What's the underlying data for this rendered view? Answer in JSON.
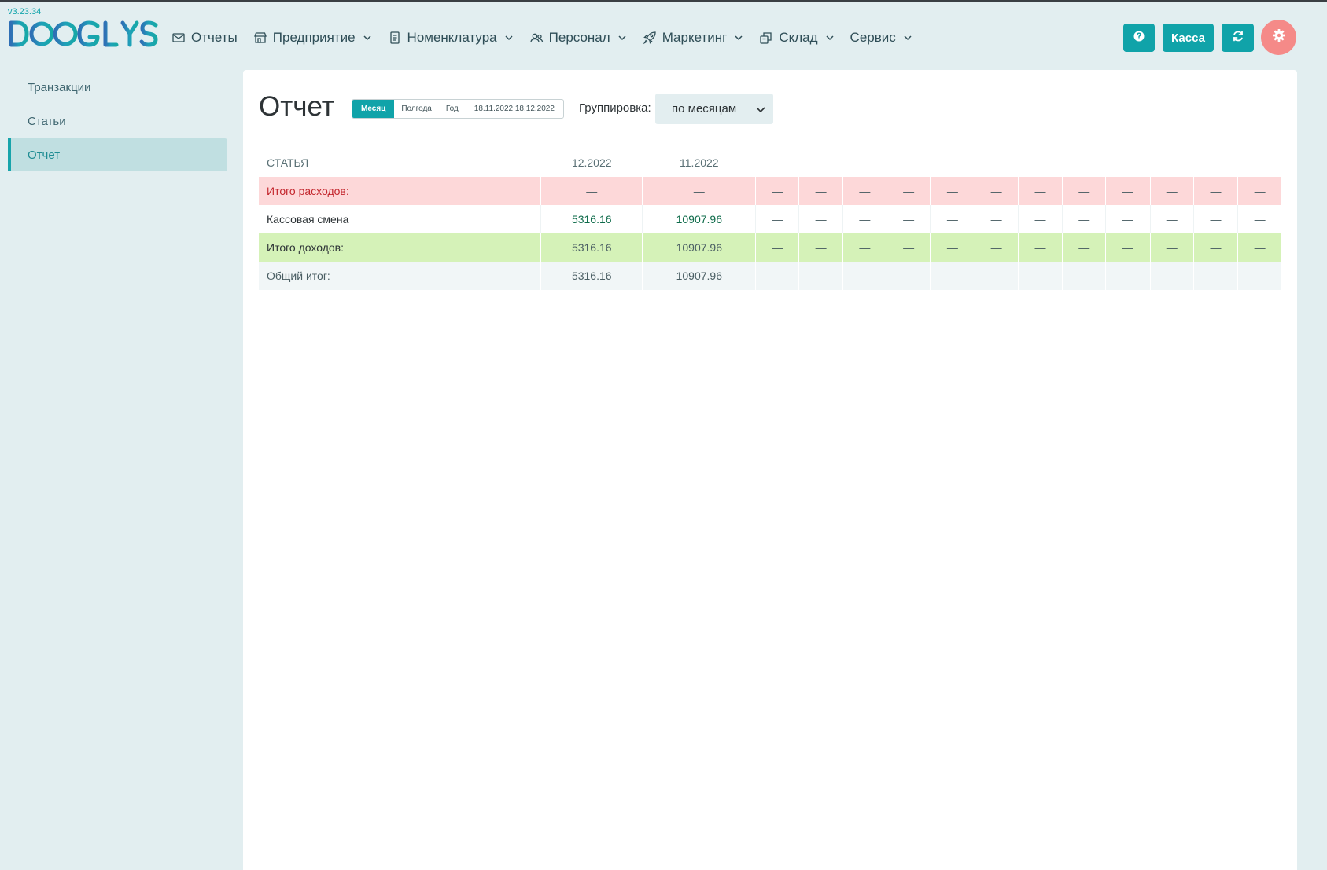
{
  "app": {
    "version": "v3.23.34",
    "logo_text": "DOOGLYS"
  },
  "nav": {
    "items": [
      {
        "label": "Отчеты",
        "icon": "reports-envelope-icon",
        "dropdown": false
      },
      {
        "label": "Предприятие",
        "icon": "shop-icon",
        "dropdown": true
      },
      {
        "label": "Номенклатура",
        "icon": "document-icon",
        "dropdown": true
      },
      {
        "label": "Персонал",
        "icon": "users-icon",
        "dropdown": true
      },
      {
        "label": "Маркетинг",
        "icon": "rocket-icon",
        "dropdown": true
      },
      {
        "label": "Склад",
        "icon": "boxes-icon",
        "dropdown": true
      },
      {
        "label": "Сервис",
        "icon": "",
        "dropdown": true
      }
    ]
  },
  "header_buttons": {
    "help_icon": "question-icon",
    "kassa_label": "Касса",
    "refresh_icon": "refresh-icon",
    "settings_icon": "gear-icon"
  },
  "colors": {
    "accent": "#10a3a9",
    "settings_button": "#f58a88",
    "expense_row": "#fdd8d9",
    "income_row": "#d5f2b8"
  },
  "sidebar": {
    "items": [
      {
        "label": "Транзакции",
        "active": false
      },
      {
        "label": "Статьи",
        "active": false
      },
      {
        "label": "Отчет",
        "active": true
      }
    ]
  },
  "report": {
    "title": "Отчет",
    "period_tabs": {
      "month": "Месяц",
      "half_year": "Полгода",
      "year": "Год",
      "selected": "Месяц",
      "dates": "18.11.2022,18.12.2022"
    },
    "grouping": {
      "label": "Группировка:",
      "value": "по месяцам"
    },
    "table": {
      "columns": [
        "СТАТЬЯ",
        "12.2022",
        "11.2022",
        "",
        "",
        "",
        "",
        "",
        "",
        "",
        "",
        "",
        "",
        "",
        ""
      ],
      "rows": [
        {
          "kind": "exp",
          "label": "Итого расходов:",
          "cells": [
            "—",
            "—",
            "—",
            "—",
            "—",
            "—",
            "—",
            "—",
            "—",
            "—",
            "—",
            "—",
            "—",
            "—"
          ]
        },
        {
          "kind": "item",
          "label": "Кассовая смена",
          "cells": [
            "5316.16",
            "10907.96",
            "—",
            "—",
            "—",
            "—",
            "—",
            "—",
            "—",
            "—",
            "—",
            "—",
            "—",
            "—"
          ]
        },
        {
          "kind": "inc",
          "label": "Итого доходов:",
          "cells": [
            "5316.16",
            "10907.96",
            "—",
            "—",
            "—",
            "—",
            "—",
            "—",
            "—",
            "—",
            "—",
            "—",
            "—",
            "—"
          ]
        },
        {
          "kind": "tot",
          "label": "Общий итог:",
          "cells": [
            "5316.16",
            "10907.96",
            "—",
            "—",
            "—",
            "—",
            "—",
            "—",
            "—",
            "—",
            "—",
            "—",
            "—",
            "—"
          ]
        }
      ]
    }
  }
}
